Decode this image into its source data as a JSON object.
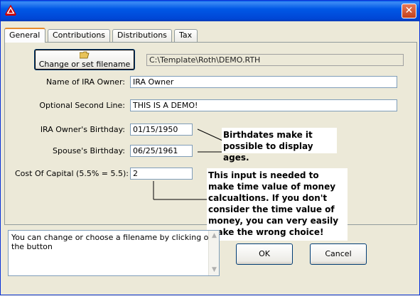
{
  "window": {
    "close_label": "✕"
  },
  "tabs": [
    {
      "label": "General"
    },
    {
      "label": "Contributions"
    },
    {
      "label": "Distributions"
    },
    {
      "label": "Tax"
    }
  ],
  "file": {
    "button_label": "Change or set filename",
    "path": "C:\\Template\\Roth\\DEMO.RTH"
  },
  "fields": {
    "owner_name_label": "Name of IRA Owner:",
    "owner_name_value": "IRA Owner",
    "second_line_label": "Optional Second Line:",
    "second_line_value": "THIS IS A DEMO!",
    "owner_birthday_label": "IRA Owner's Birthday:",
    "owner_birthday_value": "01/15/1950",
    "spouse_birthday_label": "Spouse's Birthday:",
    "spouse_birthday_value": "06/25/1961",
    "cost_of_capital_label": "Cost Of Capital (5.5% = 5.5):",
    "cost_of_capital_value": "2"
  },
  "notes": {
    "birthdates": "Birthdates make it possible to display ages.",
    "time_value": "This input is needed to make time value of money calcualtions. If you don't consider the time value of money, you can very easily make the wrong choice!"
  },
  "status_text": "You can change or choose a filename by clicking on the button",
  "buttons": {
    "ok": "OK",
    "cancel": "Cancel"
  }
}
